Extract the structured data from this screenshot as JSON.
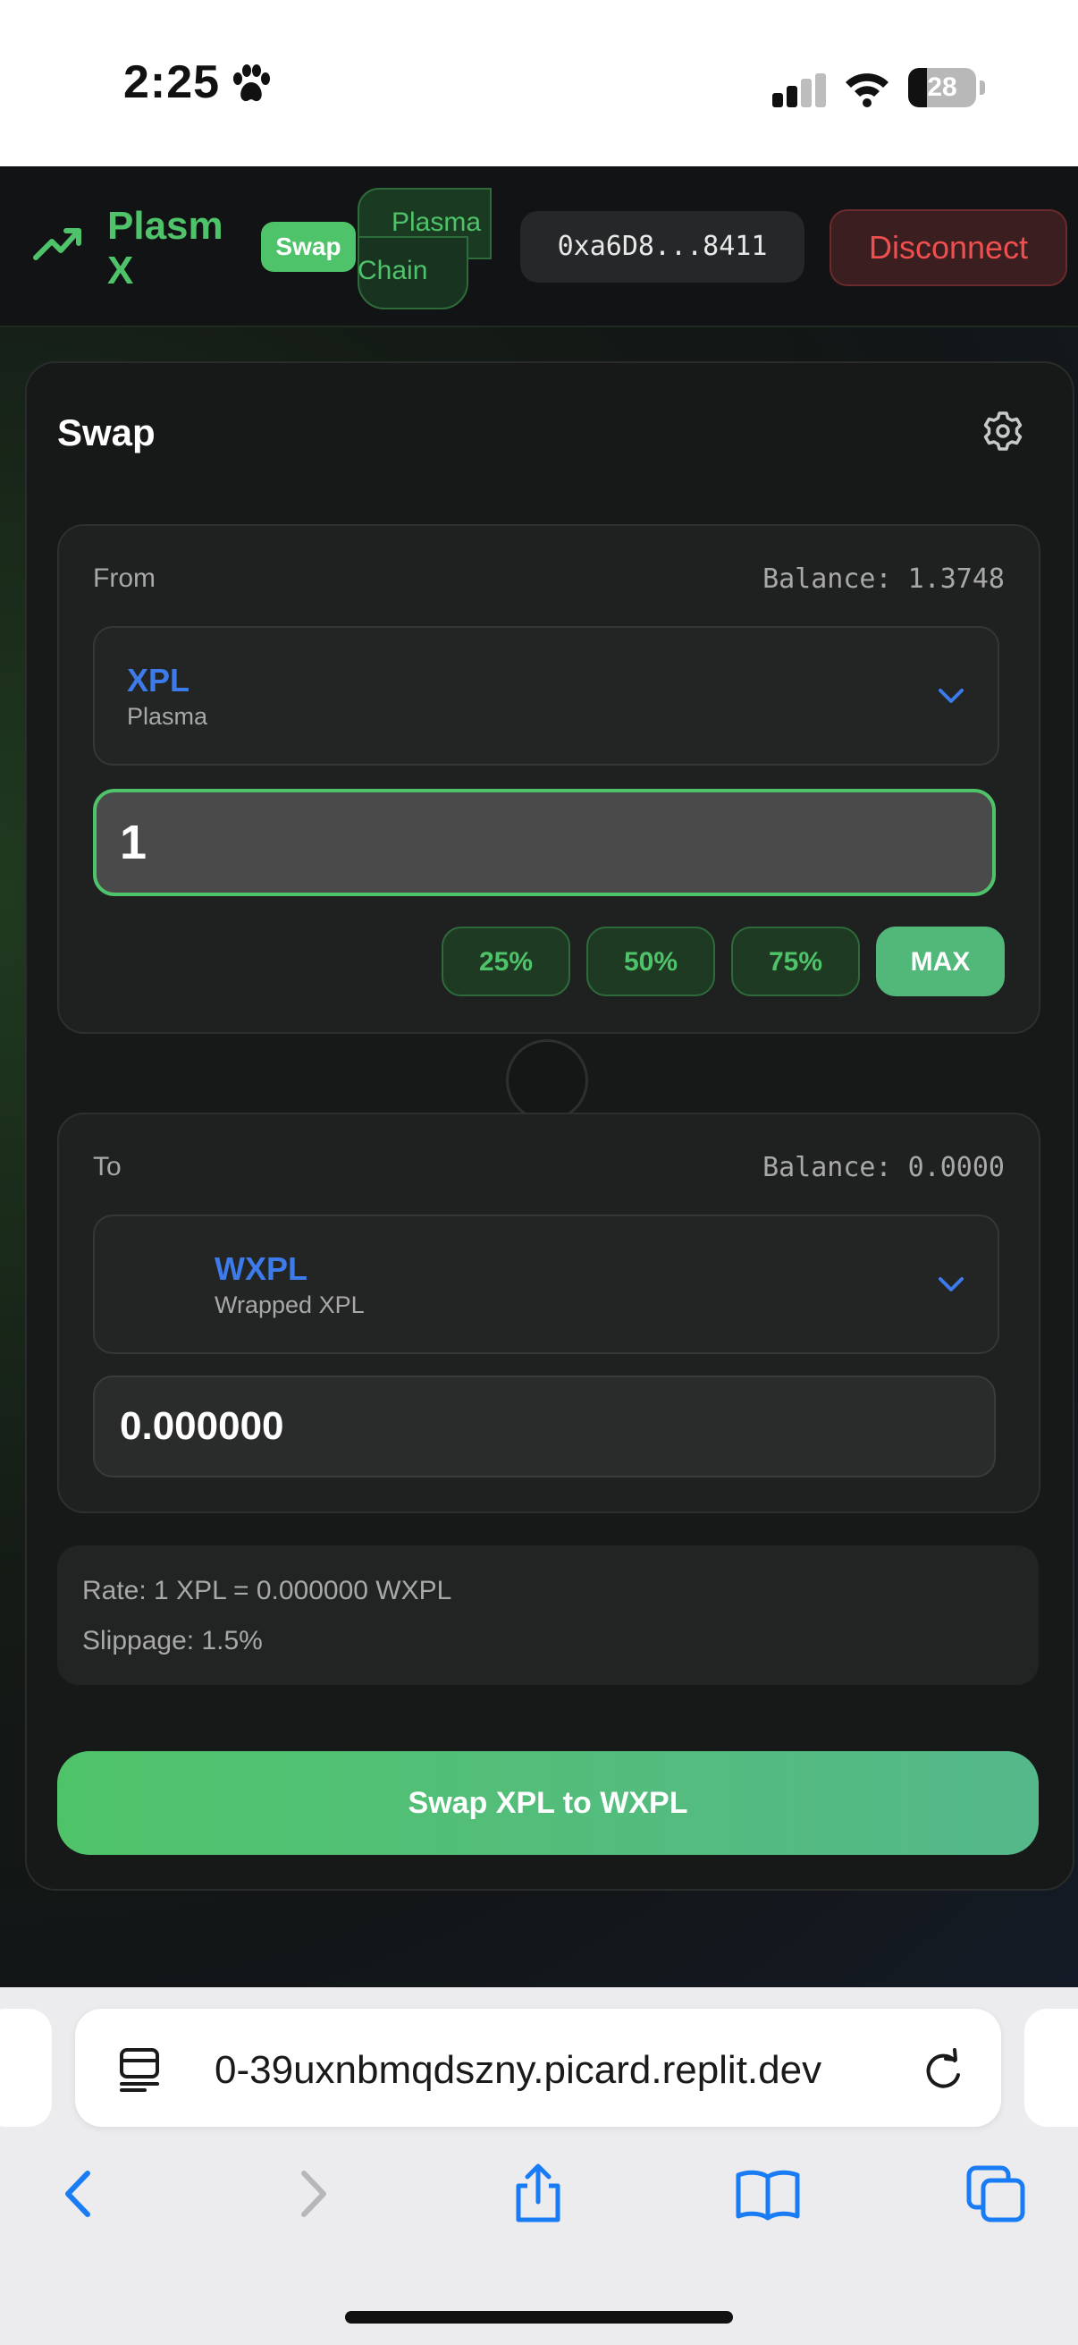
{
  "status_bar": {
    "time": "2:25",
    "battery": "28",
    "battery_level": 0.28
  },
  "header": {
    "brand": "Plasm X",
    "swap_badge": "Swap",
    "chain_line1": "Plasma",
    "chain_line2": "Chain",
    "wallet_address": "0xa6D8...8411",
    "disconnect_label": "Disconnect"
  },
  "swap_card": {
    "title": "Swap",
    "from": {
      "label": "From",
      "balance": "Balance: 1.3748",
      "token_symbol": "XPL",
      "token_name": "Plasma",
      "amount": "1",
      "percent_buttons": [
        "25%",
        "50%",
        "75%",
        "MAX"
      ]
    },
    "to": {
      "label": "To",
      "balance": "Balance: 0.0000",
      "token_symbol": "WXPL",
      "token_name": "Wrapped XPL",
      "amount": "0.000000"
    },
    "rate": "Rate: 1 XPL = 0.000000 WXPL",
    "slippage": "Slippage: 1.5%",
    "submit_label": "Swap XPL to WXPL"
  },
  "browser": {
    "url": "0-39uxnbmqdszny.picard.replit.dev"
  },
  "colors": {
    "accent": "#4fc36a",
    "token": "#3d7bea",
    "danger": "#ef4f4f",
    "ios_blue": "#1a7cf5"
  }
}
